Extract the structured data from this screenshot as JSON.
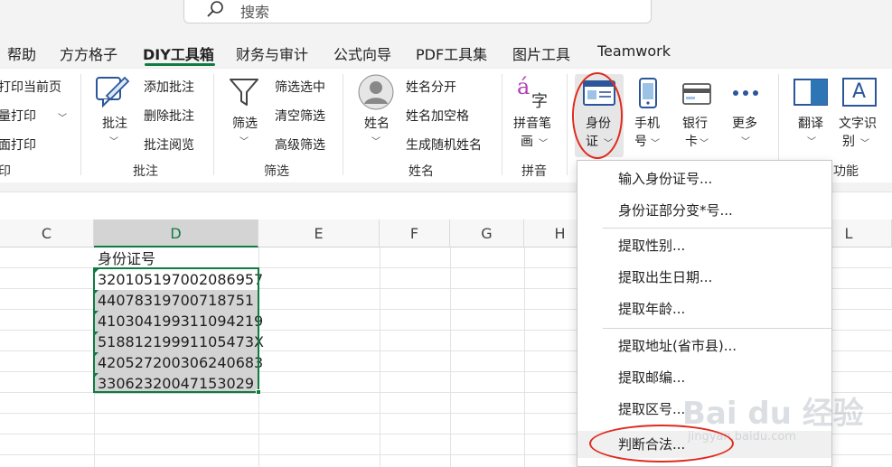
{
  "search": {
    "placeholder": "搜索"
  },
  "tabs": [
    {
      "label": "帮助"
    },
    {
      "label": "方方格子"
    },
    {
      "label": "DIY工具箱"
    },
    {
      "label": "财务与审计"
    },
    {
      "label": "公式向导"
    },
    {
      "label": "PDF工具集"
    },
    {
      "label": "图片工具"
    },
    {
      "label": "Teamwork"
    }
  ],
  "ribbon": {
    "print": {
      "items": [
        "打印当前页",
        "批量打印",
        "双面打印"
      ],
      "group": "打印",
      "visible_items": [
        "打印当前页",
        "量打印",
        "面打印"
      ],
      "visible_group": "印"
    },
    "annotation": {
      "big": "批注",
      "items": [
        "添加批注",
        "删除批注",
        "批注阅览"
      ],
      "group": "批注"
    },
    "filter": {
      "big": "筛选",
      "items": [
        "筛选选中",
        "清空筛选",
        "高级筛选"
      ],
      "group": "筛选"
    },
    "name": {
      "big": "姓名",
      "items": [
        "姓名分开",
        "姓名加空格",
        "生成随机姓名"
      ],
      "group": "姓名"
    },
    "pinyin": {
      "big1": "拼音笔",
      "big2": "画",
      "group": "拼音",
      "glyph_a": "á",
      "glyph_zi": "字"
    },
    "idcard": {
      "big1": "身份",
      "big2": "证"
    },
    "phone": {
      "big1": "手机",
      "big2": "号"
    },
    "bank": {
      "big1": "银行",
      "big2": "卡"
    },
    "more": {
      "big1": "更多"
    },
    "translate": {
      "big1": "翻译"
    },
    "ocr": {
      "big1": "文字识",
      "big2": "别",
      "glyph": "A"
    },
    "func_group_visible": "功能"
  },
  "columns": [
    "C",
    "D",
    "E",
    "F",
    "G",
    "H",
    "L"
  ],
  "sheet": {
    "header": "身份证号",
    "rows": [
      "320105197002086957",
      "44078319700718751",
      "410304199311094219",
      "51881219991105473X",
      "420527200306240683",
      "33062320047153029"
    ]
  },
  "menu": {
    "items": [
      "输入身份证号...",
      "身份证部分变*号...",
      "提取性别...",
      "提取出生日期...",
      "提取年龄...",
      "提取地址(省市县)...",
      "提取邮编...",
      "提取区号...",
      "判断合法..."
    ]
  },
  "watermark": {
    "main": "Bai du 经验",
    "sub": "jingyan.baidu.com"
  },
  "colors": {
    "accent": "#107c41",
    "annotation": "#e02a1f"
  }
}
